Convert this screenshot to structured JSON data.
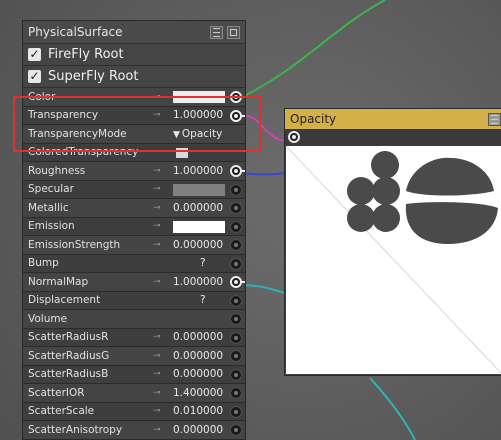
{
  "physical_node": {
    "title": "PhysicalSurface",
    "roots": [
      {
        "label": "FireFly Root",
        "checked": true
      },
      {
        "label": "SuperFly Root",
        "checked": true
      }
    ],
    "rows": [
      {
        "label": "Color",
        "kind": "swatch",
        "swatch_color": "#eeeeee",
        "socket": "connected"
      },
      {
        "label": "Transparency",
        "kind": "value",
        "value": "1.000000",
        "socket": "connected"
      },
      {
        "label": "TransparencyMode",
        "kind": "dropdown",
        "value": "Opacity",
        "socket": "none"
      },
      {
        "label": "ColoredTransparency",
        "kind": "checkbox",
        "socket": "none"
      },
      {
        "label": "Roughness",
        "kind": "value",
        "value": "1.000000",
        "socket": "connected"
      },
      {
        "label": "Specular",
        "kind": "swatch",
        "swatch_color": "#808080",
        "socket": "open"
      },
      {
        "label": "Metallic",
        "kind": "value",
        "value": "0.000000",
        "socket": "open"
      },
      {
        "label": "Emission",
        "kind": "swatch",
        "swatch_color": "#ffffff",
        "socket": "open"
      },
      {
        "label": "EmissionStrength",
        "kind": "value",
        "value": "0.000000",
        "socket": "open"
      },
      {
        "label": "Bump",
        "kind": "text",
        "value": "?",
        "socket": "open"
      },
      {
        "label": "NormalMap",
        "kind": "value",
        "value": "1.000000",
        "socket": "connected"
      },
      {
        "label": "Displacement",
        "kind": "text",
        "value": "?",
        "socket": "open"
      },
      {
        "label": "Volume",
        "kind": "none",
        "socket": "open"
      },
      {
        "label": "ScatterRadiusR",
        "kind": "value",
        "value": "0.000000",
        "socket": "open"
      },
      {
        "label": "ScatterRadiusG",
        "kind": "value",
        "value": "0.000000",
        "socket": "open"
      },
      {
        "label": "ScatterRadiusB",
        "kind": "value",
        "value": "0.000000",
        "socket": "open"
      },
      {
        "label": "ScatterIOR",
        "kind": "value",
        "value": "1.400000",
        "socket": "open"
      },
      {
        "label": "ScatterScale",
        "kind": "value",
        "value": "0.010000",
        "socket": "open"
      },
      {
        "label": "ScatterAnisotropy",
        "kind": "value",
        "value": "0.000000",
        "socket": "open"
      }
    ]
  },
  "opacity_node": {
    "title": "Opacity",
    "header_color": "#d4b04a"
  },
  "colors": {
    "canvas_bg": "#595959",
    "wire_green": "#39b54a",
    "wire_pink": "#d63fb2",
    "wire_blue": "#3a47c8",
    "wire_cyan": "#2fb3b3",
    "highlight": "#e03131"
  },
  "icons": {
    "menu": "menu-icon",
    "frame": "frame-icon",
    "key": "key-icon",
    "socket": "socket-icon"
  }
}
